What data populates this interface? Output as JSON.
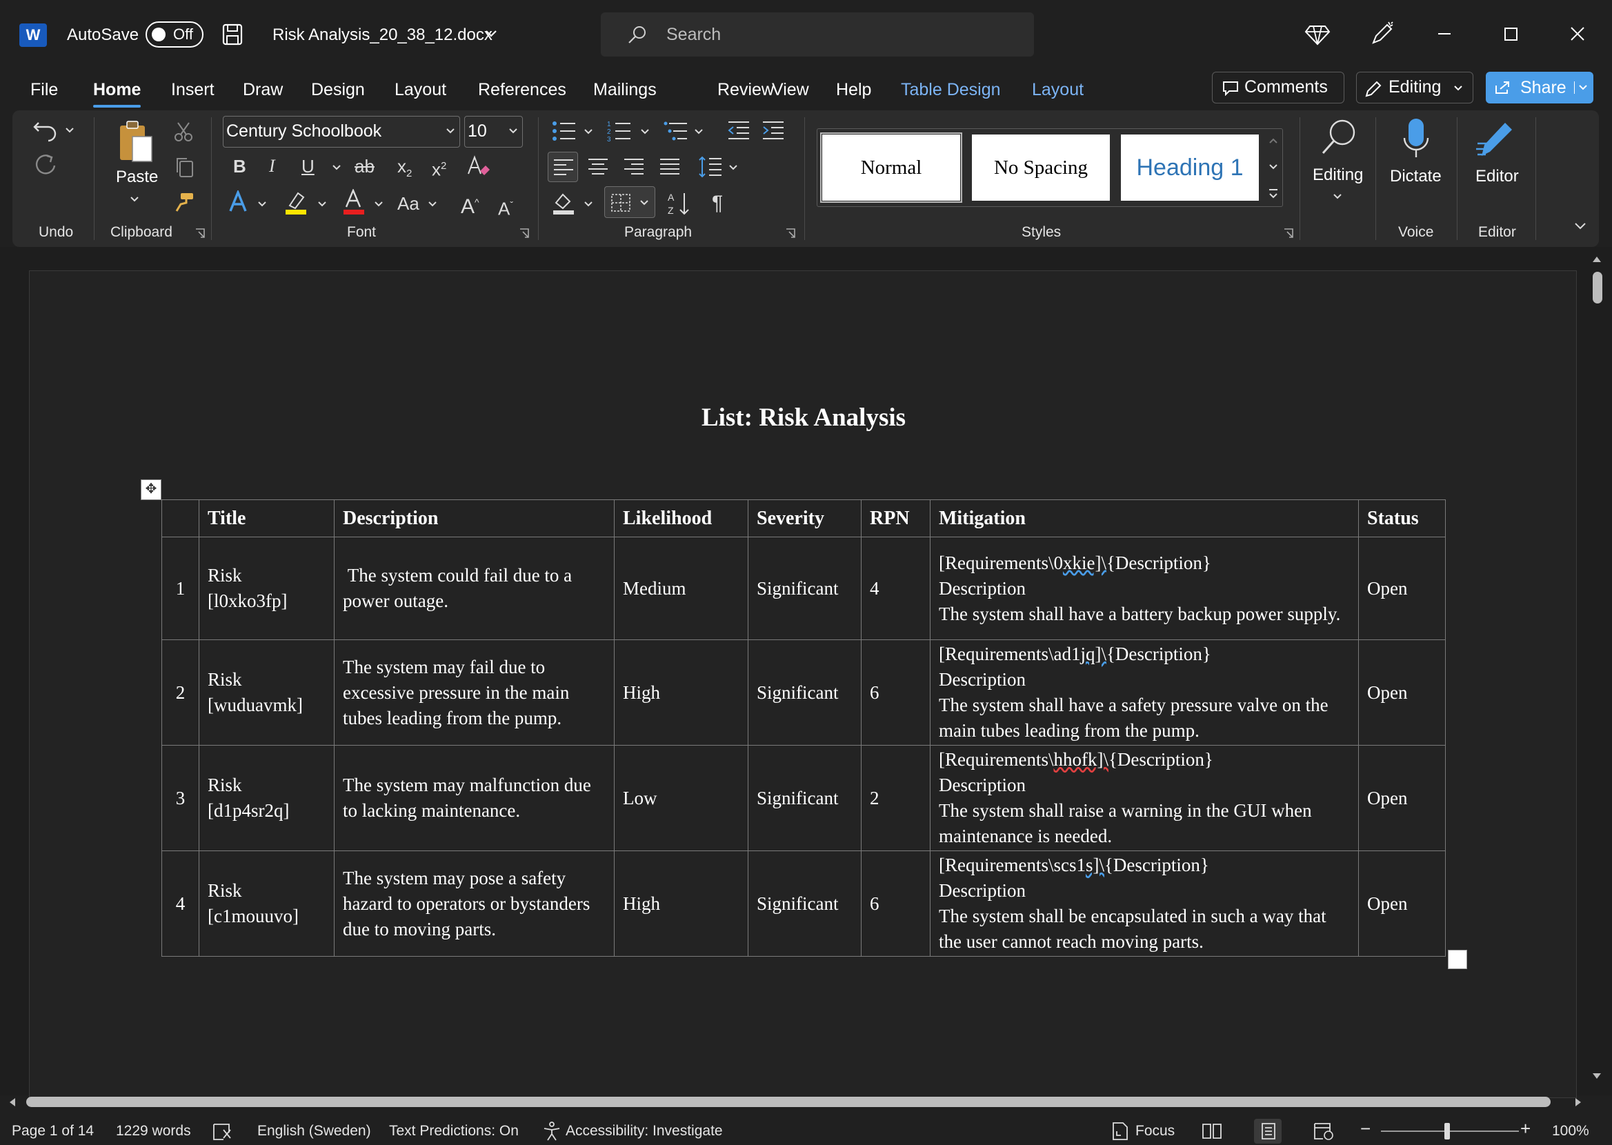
{
  "titlebar": {
    "app_logo": "W",
    "autosave_label": "AutoSave",
    "autosave_state": "Off",
    "document_title": "Risk Analysis_20_38_12.docx",
    "search_placeholder": "Search"
  },
  "tabs": [
    {
      "label": "File"
    },
    {
      "label": "Home"
    },
    {
      "label": "Insert"
    },
    {
      "label": "Draw"
    },
    {
      "label": "Design"
    },
    {
      "label": "Layout"
    },
    {
      "label": "References"
    },
    {
      "label": "Mailings"
    },
    {
      "label": "Review"
    },
    {
      "label": "View"
    },
    {
      "label": "Help"
    },
    {
      "label": "Table Design"
    },
    {
      "label": "Layout"
    }
  ],
  "active_tab": "Home",
  "actions": {
    "comments_label": "Comments",
    "editing_label": "Editing",
    "share_label": "Share"
  },
  "ribbon": {
    "undo_group": "Undo",
    "clipboard_group": "Clipboard",
    "paste_label": "Paste",
    "font_group": "Font",
    "font_name": "Century Schoolbook",
    "font_size": "10",
    "paragraph_group": "Paragraph",
    "styles_group": "Styles",
    "styles": [
      "Normal",
      "No Spacing",
      "Heading 1"
    ],
    "editing_btn": "Editing",
    "dictate_btn": "Dictate",
    "voice_group": "Voice",
    "editor_btn": "Editor",
    "editor_group": "Editor"
  },
  "document": {
    "heading": "List: Risk Analysis",
    "table": {
      "headers": [
        "",
        "Title",
        "Description",
        "Likelihood",
        "Severity",
        "RPN",
        "Mitigation",
        "Status"
      ],
      "rows": [
        {
          "num": "1",
          "title": "Risk [l0xko3fp]",
          "description": " The system could fail due to a power outage.",
          "likelihood": "Medium",
          "severity": "Significant",
          "rpn": "4",
          "mitigation_ref_pre": "[Requirements\\0",
          "mitigation_ref_mark": "xkie]\\",
          "mitigation_ref_post": "{Description}",
          "mitigation_label": "Description",
          "mitigation_text": "The system shall have a battery backup power supply.",
          "status": "Open"
        },
        {
          "num": "2",
          "title": "Risk [wuduavmk]",
          "description": "The system may fail due to excessive pressure in the main tubes leading from the pump.",
          "likelihood": "High",
          "severity": "Significant",
          "rpn": "6",
          "mitigation_ref_pre": "[Requirements\\ad1",
          "mitigation_ref_mark": "jq]\\",
          "mitigation_ref_post": "{Description}",
          "mitigation_label": "Description",
          "mitigation_text": "The system shall have a safety pressure valve on the main tubes leading from the pump.",
          "status": "Open"
        },
        {
          "num": "3",
          "title": "Risk [d1p4sr2q]",
          "description": "The system may malfunction due to lacking maintenance.",
          "likelihood": "Low",
          "severity": "Significant",
          "rpn": "2",
          "mitigation_ref_pre": "[Requirements\\",
          "mitigation_ref_mark": "hhofk]\\",
          "mitigation_ref_post": "{Description}",
          "mitigation_label": "Description",
          "mitigation_text": "The system shall raise a warning in the GUI when maintenance is needed.",
          "status": "Open"
        },
        {
          "num": "4",
          "title": "Risk [c1mouuvo]",
          "description": "The system may pose a safety hazard to operators or bystanders due to moving parts.",
          "likelihood": "High",
          "severity": "Significant",
          "rpn": "6",
          "mitigation_ref_pre": "[Requirements\\scs1",
          "mitigation_ref_mark": "s]\\",
          "mitigation_ref_post": "{Description}",
          "mitigation_label": "Description",
          "mitigation_text": "The system shall be encapsulated in such a way that the user cannot reach moving parts.",
          "status": "Open"
        }
      ]
    }
  },
  "statusbar": {
    "page": "Page 1 of 14",
    "words": "1229 words",
    "language": "English (Sweden)",
    "text_predictions": "Text Predictions: On",
    "accessibility": "Accessibility: Investigate",
    "focus": "Focus",
    "zoom": "100%"
  },
  "colors": {
    "accent": "#4a9de8",
    "background": "#202020",
    "ribbon": "#2c2c2c",
    "page": "#232323"
  }
}
